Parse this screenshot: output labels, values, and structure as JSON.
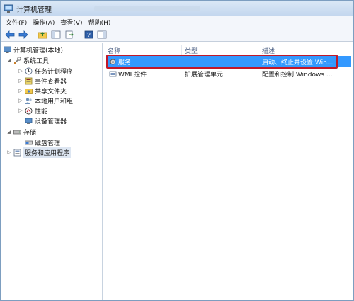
{
  "window": {
    "title": "计算机管理"
  },
  "menu": [
    "文件(F)",
    "操作(A)",
    "查看(V)",
    "帮助(H)"
  ],
  "tree": {
    "root": "计算机管理(本地)",
    "system_tools": "系统工具",
    "task_scheduler": "任务计划程序",
    "event_viewer": "事件查看器",
    "shared_folders": "共享文件夹",
    "local_users": "本地用户和组",
    "performance": "性能",
    "device_manager": "设备管理器",
    "storage": "存储",
    "disk_management": "磁盘管理",
    "services_apps": "服务和应用程序"
  },
  "list": {
    "headers": {
      "name": "名称",
      "type": "类型",
      "description": "描述"
    },
    "rows": [
      {
        "name": "服务",
        "type": "",
        "description": "启动、终止并设置 Win..."
      },
      {
        "name": "WMI 控件",
        "type": "扩展管理单元",
        "description": "配置和控制 Windows ..."
      }
    ]
  },
  "colors": {
    "selection": "#3399ff",
    "highlight_border": "#c0182a",
    "titlebar": "#c2d6ee"
  }
}
